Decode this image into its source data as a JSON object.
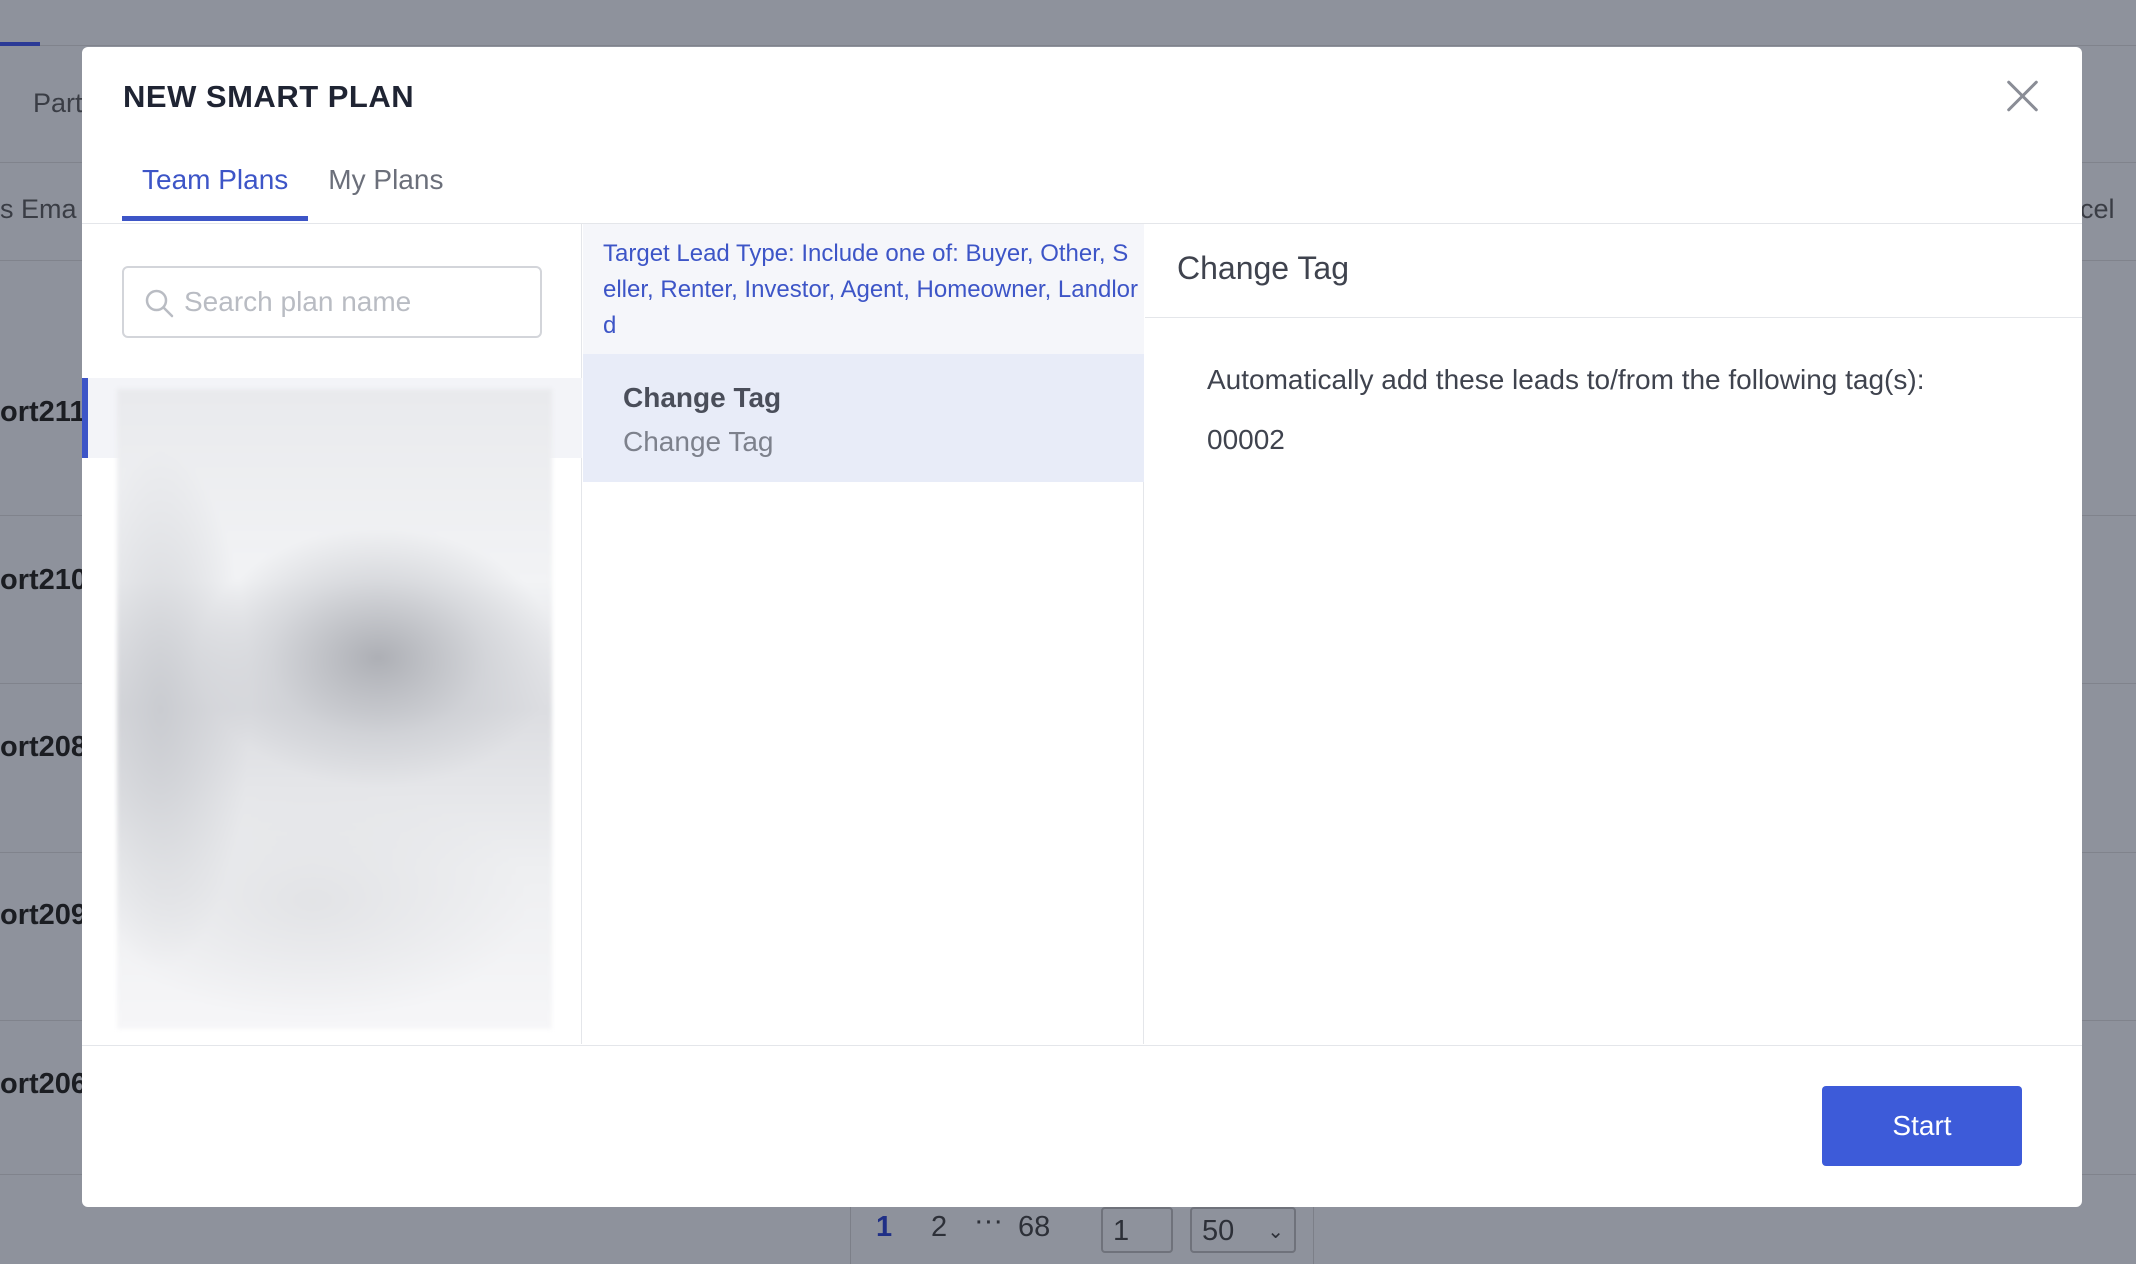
{
  "background": {
    "toolbar_partial": "Part",
    "column_partial_left": "s Ema",
    "column_partial_right": "cel",
    "rows": [
      "ort211",
      "ort210",
      "ort208",
      "ort209",
      "ort206"
    ],
    "pagination": {
      "current": "1",
      "next": "2",
      "ellipsis": "···",
      "last": "68",
      "goto_value": "1",
      "page_size": "50"
    }
  },
  "modal": {
    "title": "NEW SMART PLAN",
    "tabs": [
      {
        "label": "Team Plans",
        "active": true
      },
      {
        "label": "My Plans",
        "active": false
      }
    ],
    "search": {
      "placeholder": "Search plan name",
      "value": ""
    },
    "target_info": "Target Lead Type: Include one of: Buyer, Other, Seller, Renter, Investor, Agent, Homeowner, Landlord",
    "action": {
      "title": "Change Tag",
      "subtitle": "Change Tag"
    },
    "detail": {
      "header": "Change Tag",
      "description": "Automatically add these leads to/from the following tag(s):",
      "tag": "00002"
    },
    "start_label": "Start"
  },
  "colors": {
    "accent": "#3d55c7",
    "button": "#3d5bd9"
  }
}
